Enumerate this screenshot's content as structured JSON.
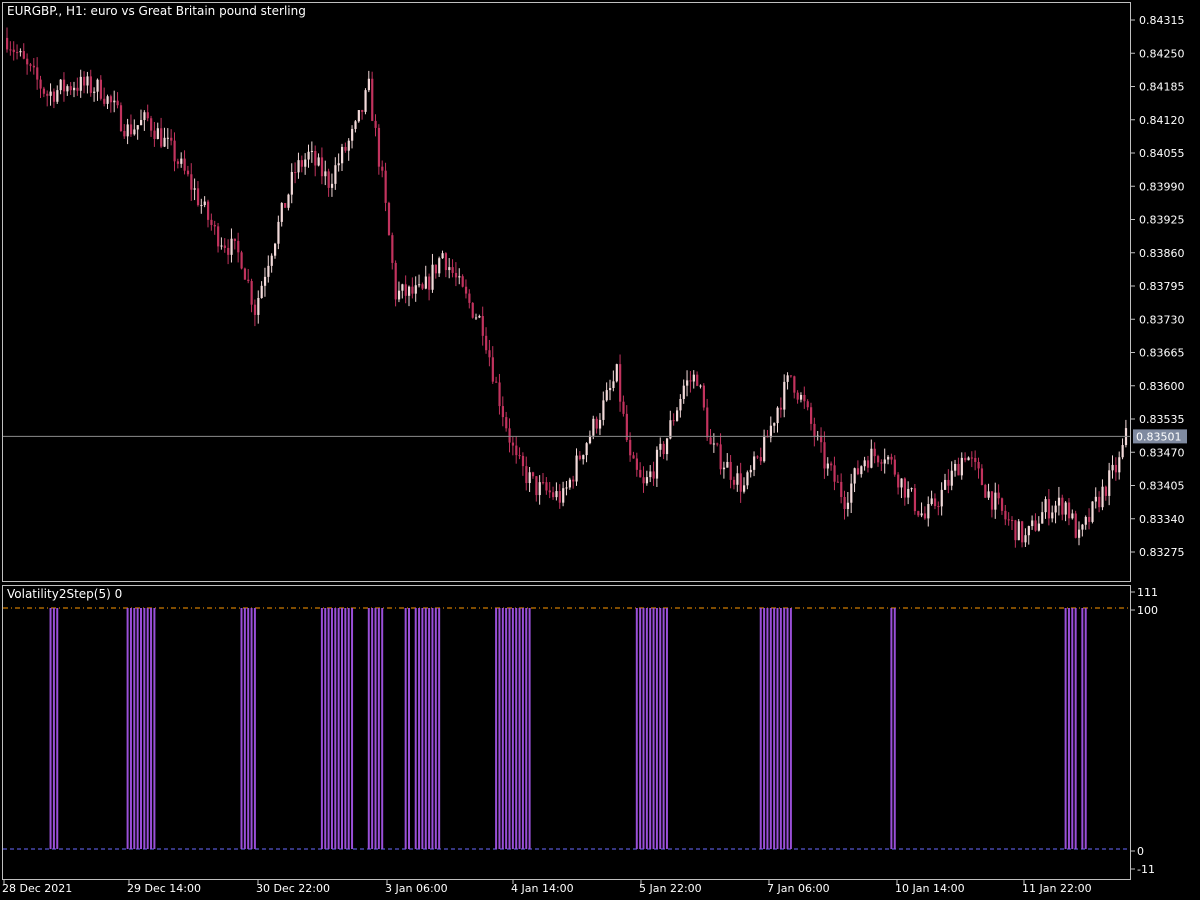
{
  "main_title": "EURGBP., H1:  euro vs Great Britain pound sterling",
  "indicator_title": "Volatility2Step(5) 0",
  "current_price": "0.83501",
  "colors": {
    "background": "#000000",
    "frame": "#bfbfbf",
    "bear_candle": "#c2335e",
    "bull_candle": "#f3dada",
    "histogram": "#9a4fd8",
    "level_100": "#ff9900",
    "level_0": "#6a6aff",
    "price_line": "#8c8c8c",
    "price_label_bg": "#7f8aa0"
  },
  "price_axis": [
    "0.84315",
    "0.84250",
    "0.84185",
    "0.84120",
    "0.84055",
    "0.83990",
    "0.83925",
    "0.83860",
    "0.83795",
    "0.83730",
    "0.83665",
    "0.83600",
    "0.83535",
    "0.83470",
    "0.83405",
    "0.83340",
    "0.83275"
  ],
  "indicator_axis": [
    "111",
    "100",
    "0",
    "-11"
  ],
  "time_axis": [
    "28 Dec 2021",
    "29 Dec 14:00",
    "30 Dec 22:00",
    "3 Jan 06:00",
    "4 Jan 14:00",
    "5 Jan 22:00",
    "7 Jan 06:00",
    "10 Jan 14:00",
    "11 Jan 22:00"
  ],
  "chart_data": {
    "type": "candlestick",
    "symbol": "EURGBP.",
    "timeframe": "H1",
    "price_range": [
      0.8322,
      0.8436
    ],
    "price_path": [
      [
        0,
        0.8428
      ],
      [
        6,
        0.8422
      ],
      [
        12,
        0.8417
      ],
      [
        20,
        0.8419
      ],
      [
        28,
        0.8418
      ],
      [
        36,
        0.841
      ],
      [
        42,
        0.8412
      ],
      [
        50,
        0.8405
      ],
      [
        56,
        0.8398
      ],
      [
        62,
        0.839
      ],
      [
        70,
        0.8385
      ],
      [
        74,
        0.8375
      ],
      [
        78,
        0.8385
      ],
      [
        86,
        0.8402
      ],
      [
        90,
        0.8405
      ],
      [
        96,
        0.84
      ],
      [
        104,
        0.841
      ],
      [
        108,
        0.8418
      ],
      [
        112,
        0.84
      ],
      [
        116,
        0.8378
      ],
      [
        124,
        0.8378
      ],
      [
        130,
        0.8386
      ],
      [
        136,
        0.8378
      ],
      [
        142,
        0.8372
      ],
      [
        146,
        0.836
      ],
      [
        152,
        0.8345
      ],
      [
        158,
        0.834
      ],
      [
        166,
        0.8338
      ],
      [
        172,
        0.8348
      ],
      [
        178,
        0.8356
      ],
      [
        182,
        0.8362
      ],
      [
        186,
        0.8345
      ],
      [
        190,
        0.834
      ],
      [
        196,
        0.8348
      ],
      [
        202,
        0.836
      ],
      [
        206,
        0.8362
      ],
      [
        210,
        0.8348
      ],
      [
        214,
        0.8345
      ],
      [
        220,
        0.834
      ],
      [
        226,
        0.8348
      ],
      [
        230,
        0.8356
      ],
      [
        234,
        0.8362
      ],
      [
        238,
        0.8356
      ],
      [
        244,
        0.8345
      ],
      [
        250,
        0.8338
      ],
      [
        256,
        0.8346
      ],
      [
        262,
        0.8347
      ],
      [
        268,
        0.834
      ],
      [
        274,
        0.8334
      ],
      [
        280,
        0.834
      ],
      [
        286,
        0.8347
      ],
      [
        292,
        0.834
      ],
      [
        298,
        0.8334
      ],
      [
        304,
        0.833
      ],
      [
        310,
        0.8336
      ],
      [
        316,
        0.8337
      ],
      [
        320,
        0.833
      ],
      [
        326,
        0.8338
      ],
      [
        332,
        0.8345
      ],
      [
        334,
        0.835
      ]
    ],
    "last_price": 0.83501,
    "indicator": {
      "name": "Volatility2Step(5) 0",
      "range": [
        -11,
        111
      ],
      "levels": [
        100,
        0
      ],
      "values": [
        0,
        0,
        0,
        0,
        0,
        0,
        0,
        0,
        0,
        0,
        0,
        0,
        0,
        100,
        100,
        100,
        0,
        0,
        0,
        0,
        0,
        0,
        0,
        0,
        0,
        0,
        0,
        0,
        0,
        0,
        0,
        0,
        0,
        0,
        0,
        0,
        100,
        100,
        100,
        100,
        100,
        100,
        100,
        100,
        100,
        0,
        0,
        0,
        0,
        0,
        0,
        0,
        0,
        0,
        0,
        0,
        0,
        0,
        0,
        0,
        0,
        0,
        0,
        0,
        0,
        0,
        0,
        0,
        0,
        0,
        100,
        100,
        100,
        100,
        100,
        0,
        0,
        0,
        0,
        0,
        0,
        0,
        0,
        0,
        0,
        0,
        0,
        0,
        0,
        0,
        0,
        0,
        0,
        0,
        100,
        100,
        100,
        100,
        100,
        100,
        100,
        100,
        100,
        100,
        0,
        0,
        0,
        0,
        100,
        100,
        100,
        100,
        100,
        0,
        0,
        0,
        0,
        0,
        0,
        100,
        100,
        0,
        100,
        100,
        100,
        100,
        100,
        100,
        100,
        100,
        0,
        0,
        0,
        0,
        0,
        0,
        0,
        0,
        0,
        0,
        0,
        0,
        0,
        0,
        0,
        0,
        100,
        100,
        100,
        100,
        100,
        100,
        100,
        100,
        100,
        100,
        100,
        0,
        0,
        0,
        0,
        0,
        0,
        0,
        0,
        0,
        0,
        0,
        0,
        0,
        0,
        0,
        0,
        0,
        0,
        0,
        0,
        0,
        0,
        0,
        0,
        0,
        0,
        0,
        0,
        0,
        0,
        0,
        100,
        100,
        100,
        100,
        100,
        100,
        100,
        100,
        100,
        100,
        0,
        0,
        0,
        0,
        0,
        0,
        0,
        0,
        0,
        0,
        0,
        0,
        0,
        0,
        0,
        0,
        0,
        0,
        0,
        0,
        0,
        0,
        0,
        0,
        0,
        0,
        0,
        100,
        100,
        100,
        100,
        100,
        100,
        100,
        100,
        100,
        100,
        0,
        0,
        0,
        0,
        0,
        0,
        0,
        0,
        0,
        0,
        0,
        0,
        0,
        0,
        0,
        0,
        0,
        0,
        0,
        0,
        0,
        0,
        0,
        0,
        0,
        0,
        0,
        0,
        0,
        100,
        100,
        0,
        0,
        0,
        0,
        0,
        0,
        0,
        0,
        0,
        0,
        0,
        0,
        0,
        0,
        0,
        0,
        0,
        0,
        0,
        0,
        0,
        0,
        0,
        0,
        0,
        0,
        0,
        0,
        0,
        0,
        0,
        0,
        0,
        0,
        0,
        0,
        0,
        0,
        0,
        0,
        0,
        0,
        0,
        0,
        0,
        0,
        0,
        0,
        0,
        0,
        100,
        100,
        100,
        100,
        0,
        100,
        100,
        0,
        0,
        0,
        0,
        0,
        0,
        0,
        0,
        0,
        0,
        0,
        0,
        0,
        0,
        0,
        0,
        0,
        0,
        0,
        0,
        0,
        0,
        0,
        0,
        0,
        0,
        0,
        0,
        0
      ]
    }
  }
}
